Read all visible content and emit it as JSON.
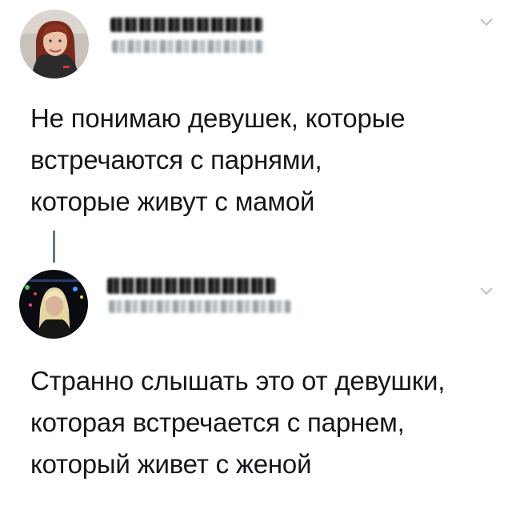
{
  "tweets": [
    {
      "avatar_icon": "woman-red-hair-avatar",
      "text_lines": [
        "Не понимаю девушек, которые",
        "встречаются с парнями,",
        "которые живут с мамой"
      ]
    },
    {
      "avatar_icon": "woman-blonde-concert-avatar",
      "text_lines": [
        "Странно слышать это от девушки,",
        "которая встречается с парнем,",
        "который живет с женой"
      ]
    }
  ],
  "colors": {
    "text": "#14171a",
    "thread_line": "#657786",
    "caret": "#aab8c2"
  }
}
